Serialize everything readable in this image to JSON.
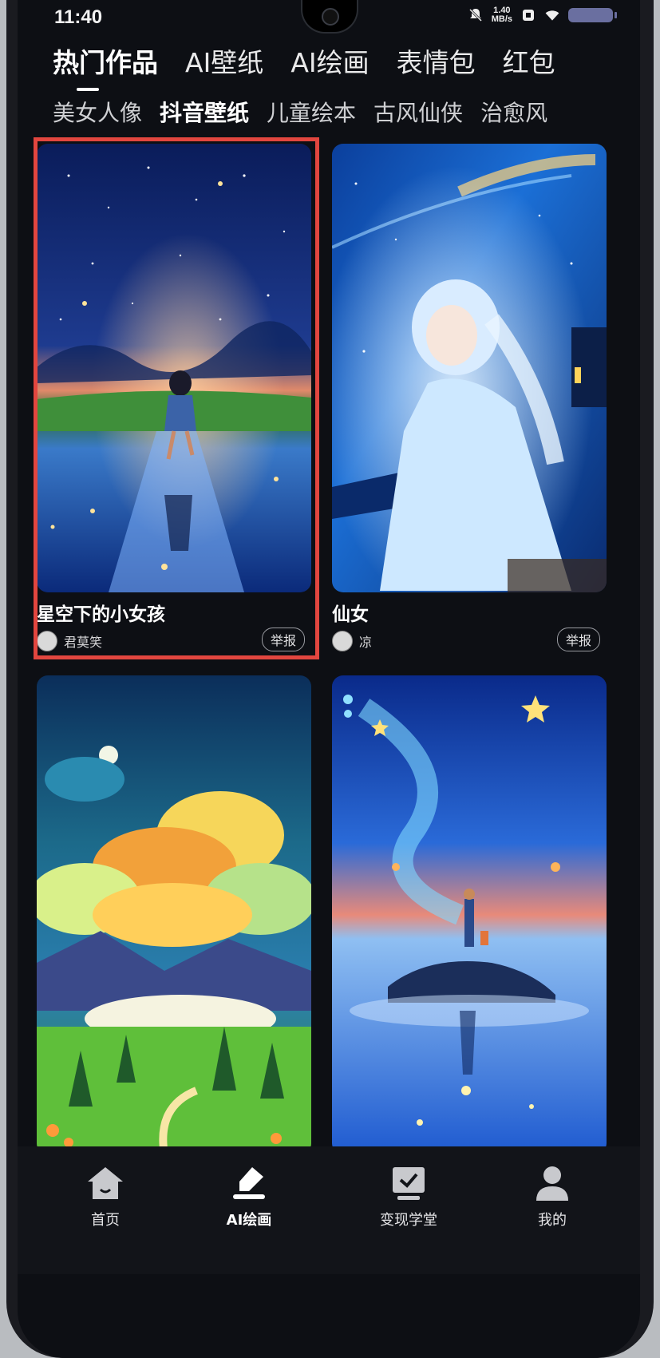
{
  "status_bar": {
    "time": "11:40",
    "speed_value": "1.40",
    "speed_unit": "MB/s"
  },
  "tabs": [
    {
      "label": "热门作品",
      "active": true
    },
    {
      "label": "AI壁纸",
      "active": false
    },
    {
      "label": "AI绘画",
      "active": false
    },
    {
      "label": "表情包",
      "active": false
    },
    {
      "label": "红包",
      "active": false
    }
  ],
  "subtabs": [
    {
      "label": "美女人像",
      "active": false
    },
    {
      "label": "抖音壁纸",
      "active": true
    },
    {
      "label": "儿童绘本",
      "active": false
    },
    {
      "label": "古风仙侠",
      "active": false
    },
    {
      "label": "治愈风",
      "active": false
    }
  ],
  "cards": [
    {
      "title": "星空下的小女孩",
      "author": "君莫笑",
      "report_label": "举报"
    },
    {
      "title": "仙女",
      "author": "凉",
      "report_label": "举报"
    },
    {
      "title": "",
      "author": "",
      "report_label": ""
    },
    {
      "title": "",
      "author": "",
      "report_label": ""
    }
  ],
  "bottom_nav": [
    {
      "label": "首页",
      "icon": "home-icon",
      "active": false
    },
    {
      "label": "AI绘画",
      "icon": "brush-icon",
      "active": true
    },
    {
      "label": "变现学堂",
      "icon": "screen-check-icon",
      "active": false
    },
    {
      "label": "我的",
      "icon": "user-icon",
      "active": false
    }
  ],
  "colors": {
    "background": "#0d0f14",
    "highlight_border": "#e2463f",
    "text": "#ffffff"
  }
}
